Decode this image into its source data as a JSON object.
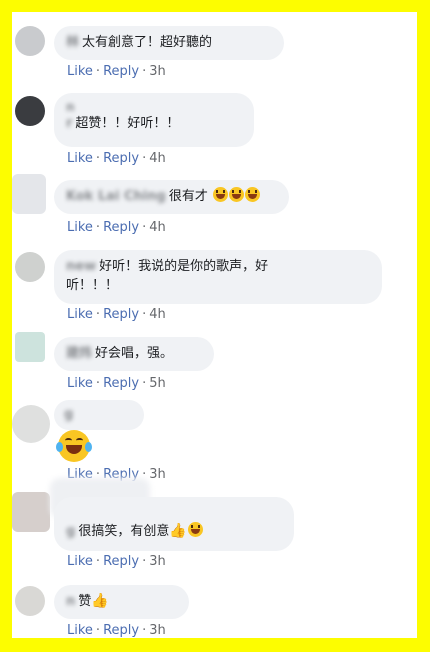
{
  "actions": {
    "like": "Like",
    "reply": "Reply",
    "sep": "·"
  },
  "comments": [
    {
      "author": "林",
      "text": "太有創意了！超好聽的",
      "time": "3h"
    },
    {
      "author_line1": "n",
      "author_line2": "r",
      "text": "超赞！！好听！！",
      "time": "4h"
    },
    {
      "author": "Kok Lai Ching",
      "text": "很有才",
      "emojis": [
        "grin-icon",
        "grin-icon",
        "grin-icon"
      ],
      "time": "4h"
    },
    {
      "author": "new",
      "text_line1": "好听！我说的是你的歌声，好",
      "text_line2": "听！！！",
      "time": "4h"
    },
    {
      "author": "建炜",
      "text": "好会唱，强。",
      "time": "5h"
    },
    {
      "author": "g",
      "sticker": "tears-of-joy-icon",
      "time": "3h"
    },
    {
      "author": "g",
      "text": "很搞笑，有创意",
      "emojis": [
        "thumbs-up-icon",
        "grin-icon"
      ],
      "time": "3h"
    },
    {
      "author": "n",
      "text": "赞",
      "emojis": [
        "thumbs-up-icon"
      ],
      "time": "3h"
    }
  ],
  "colors": {
    "frame": "#fdfd00",
    "bubble": "#f0f2f5",
    "link": "#4b6db1",
    "meta": "#65676b"
  }
}
